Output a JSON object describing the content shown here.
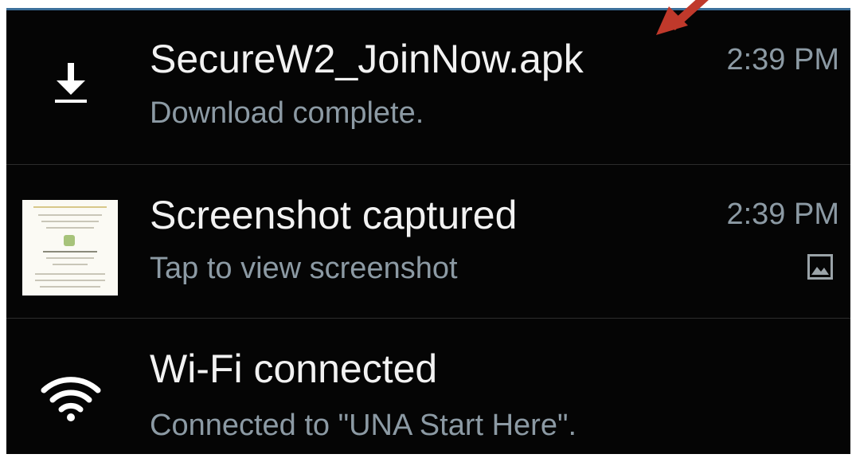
{
  "notifications": [
    {
      "icon": "download-icon",
      "title": "SecureW2_JoinNow.apk",
      "subtitle": "Download complete.",
      "time": "2:39 PM"
    },
    {
      "icon": "screenshot-thumbnail",
      "title": "Screenshot captured",
      "subtitle": "Tap to view screenshot",
      "time": "2:39 PM",
      "badge_icon": "image-icon"
    },
    {
      "icon": "wifi-icon",
      "title": "Wi-Fi connected",
      "subtitle": "Connected to \"UNA Start Here\"."
    }
  ],
  "annotation": {
    "icon": "red-arrow-icon",
    "color": "#c0392b"
  },
  "colors": {
    "background": "#050505",
    "title": "#f2f2f2",
    "subtitle": "#8c9aa4",
    "accent": "#3c6f9a"
  }
}
